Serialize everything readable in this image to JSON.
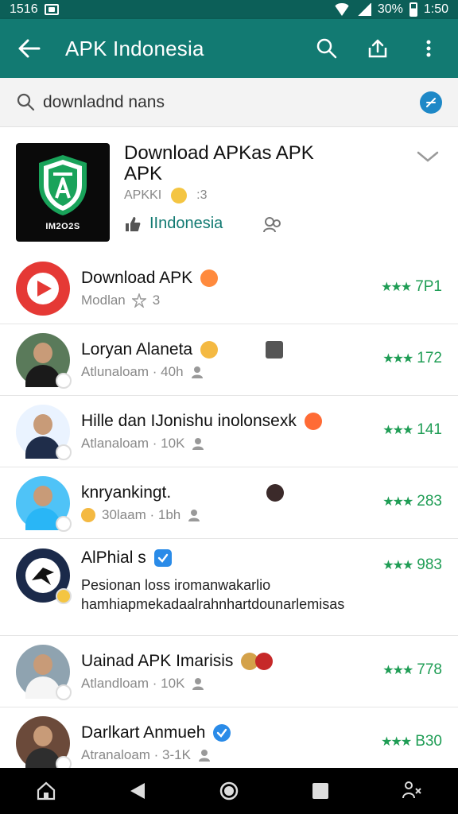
{
  "status_bar": {
    "left_text": "1516",
    "battery_percent": "30%",
    "time": "1:50"
  },
  "app_bar": {
    "title": "APK Indonesia"
  },
  "search": {
    "query": "downladnd nans"
  },
  "featured": {
    "title_line1": "Download APKas APK",
    "title_line2": "APK",
    "subtitle": "APKKI",
    "subtitle_count": ":3",
    "language": "IIndonesia",
    "logo_text": "IM2O2S"
  },
  "items": [
    {
      "name": "Download APK",
      "meta": "Modlan",
      "meta_count": "3",
      "rating": "7P1",
      "avatar_color": "#e53935"
    },
    {
      "name": "Loryan Alaneta",
      "meta": "Atlunaloam · 40h",
      "rating": "172",
      "avatar_color": "#5a7a5a"
    },
    {
      "name": "Hille dan IJonishu inolonsexk",
      "meta": "Atlanaloam · 10K",
      "rating": "141",
      "avatar_color": "#eaf3ff"
    },
    {
      "name": "knryankingt.",
      "meta": "30laam · 1bh",
      "rating": "283",
      "avatar_color": "#4fc3f7"
    },
    {
      "name": "AlPhial s",
      "desc_line1": "Pesionan loss iromanwakarlio",
      "desc_line2": "hamhiapmekadaalrahnhartdounarlemisas",
      "rating": "983",
      "avatar_color": "#1b2a4a"
    },
    {
      "name": "Uainad APK Imarisis",
      "meta": "Atlandloam · 10K",
      "rating": "778",
      "avatar_color": "#8fa3b0"
    },
    {
      "name": "Darlkart Anmueh",
      "meta": "Atranaloam · 3-1K",
      "rating": "B30",
      "avatar_color": "#6b4a3a"
    }
  ],
  "stars": "★★★",
  "colors": {
    "status_bar": "#0c5f58",
    "app_bar": "#127a72",
    "accent_green": "#1f9d55",
    "link": "#127a72"
  },
  "icons": {
    "back": "arrow-left-icon",
    "search": "search-icon",
    "share": "share-icon",
    "more": "more-vert-icon",
    "voice": "voice-search-icon"
  }
}
